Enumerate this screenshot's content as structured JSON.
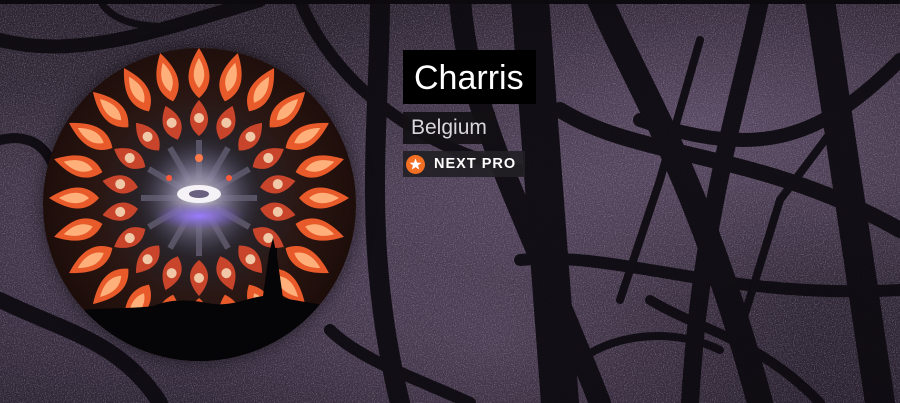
{
  "profile": {
    "name": "Charris",
    "country": "Belgium",
    "badge_label": "NEXT PRO"
  },
  "icons": {
    "badge": "star-icon",
    "avatar": "kaleidoscope-avatar-image",
    "background": "bare-tree-branches-image"
  },
  "colors": {
    "badge_accent": "#f26f23",
    "name_background": "#000000",
    "name_text": "#ffffff",
    "country_text": "#d9d6dc"
  }
}
